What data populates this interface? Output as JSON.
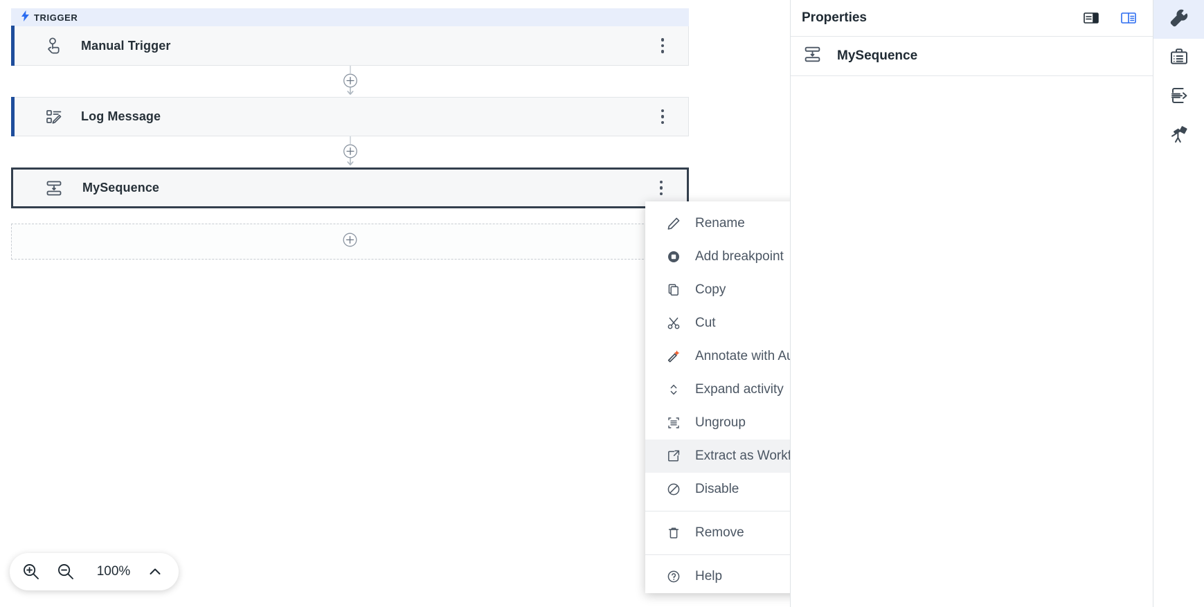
{
  "canvas": {
    "trigger_section": {
      "label": "TRIGGER",
      "icon": "lightning-bolt-icon"
    },
    "nodes": [
      {
        "title": "Manual Trigger",
        "icon": "tap-hand-icon",
        "selected": false
      },
      {
        "title": "Log Message",
        "icon": "log-message-icon",
        "selected": false
      },
      {
        "title": "MySequence",
        "icon": "sequence-icon",
        "selected": true
      }
    ],
    "add_placeholder": {
      "icon": "plus-circle-icon"
    },
    "connector_icon": "plus-circle-icon",
    "zoom_controls": {
      "zoom_in": "zoom-in-icon",
      "zoom_out": "zoom-out-icon",
      "level": "100%",
      "caret": "chevron-up-icon"
    }
  },
  "properties_panel": {
    "title": "Properties",
    "layout_buttons": [
      {
        "name": "panel-layout-left-icon",
        "active": false
      },
      {
        "name": "panel-layout-right-icon",
        "active": true
      }
    ],
    "subject": {
      "name": "MySequence",
      "icon": "sequence-icon"
    }
  },
  "right_rail": [
    {
      "name": "wrench-icon",
      "active": true
    },
    {
      "name": "briefcase-icon",
      "active": false
    },
    {
      "name": "import-arrow-icon",
      "active": false
    },
    {
      "name": "telescope-icon",
      "active": false
    }
  ],
  "context_menu": {
    "groups": [
      {
        "items": [
          {
            "label": "Rename",
            "icon": "pencil-icon",
            "highlight": false
          },
          {
            "label": "Add breakpoint",
            "icon": "breakpoint-icon",
            "highlight": false
          },
          {
            "label": "Copy",
            "icon": "copy-icon",
            "highlight": false
          },
          {
            "label": "Cut",
            "icon": "scissors-icon",
            "highlight": false
          },
          {
            "label": "Annotate with Autopilot",
            "icon": "autopilot-wand-icon",
            "highlight": false
          },
          {
            "label": "Expand activity",
            "icon": "expand-vertical-icon",
            "highlight": false
          },
          {
            "label": "Ungroup",
            "icon": "ungroup-icon",
            "highlight": false
          },
          {
            "label": "Extract as Workflow",
            "icon": "extract-workflow-icon",
            "highlight": true
          },
          {
            "label": "Disable",
            "icon": "disable-icon",
            "highlight": false
          }
        ]
      },
      {
        "items": [
          {
            "label": "Remove",
            "icon": "trash-icon",
            "highlight": false
          }
        ]
      },
      {
        "items": [
          {
            "label": "Help",
            "icon": "help-circle-icon",
            "highlight": false
          }
        ]
      }
    ]
  },
  "colors": {
    "accent_blue": "#1f4e9c",
    "trigger_bg": "#e8eefb",
    "selected_border": "#333f4d",
    "autopilot_orange": "#f05a28",
    "icon_gray": "#4b5663"
  }
}
